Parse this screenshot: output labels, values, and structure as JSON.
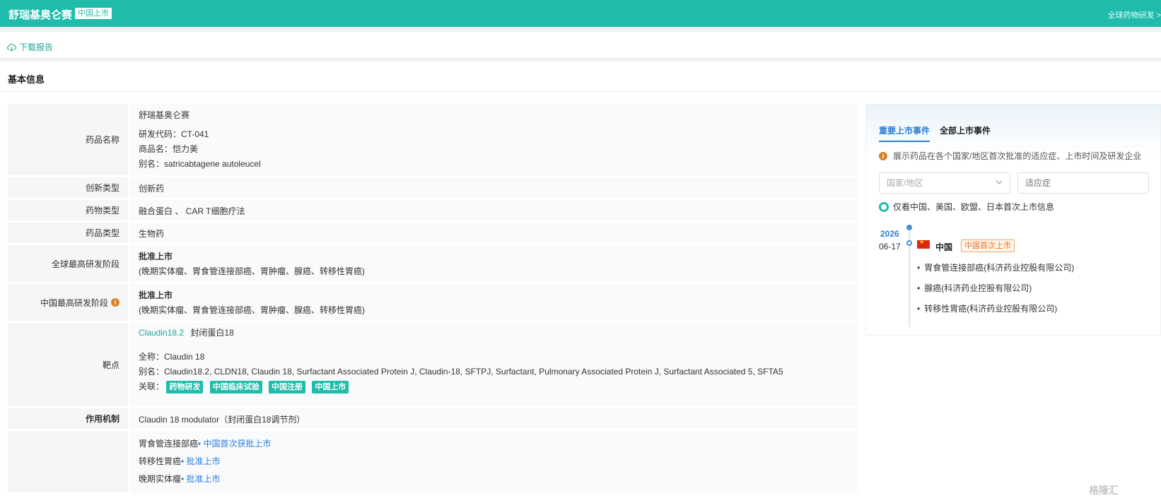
{
  "header": {
    "title": "舒瑞基奥仑赛",
    "badge": "中国上市",
    "global_link": "全球药物研发 >"
  },
  "toolbar": {
    "download_label": "下载报告"
  },
  "section": {
    "title": "基本信息"
  },
  "info": {
    "name": {
      "label": "药品名称",
      "main": "舒瑞基奥仑赛",
      "code": "研发代码：CT-041",
      "brand": "商品名：恺力美",
      "alias": "别名：satricabtagene autoleucel"
    },
    "innovation": {
      "label": "创新类型",
      "value": "创新药"
    },
    "drug_type": {
      "label": "药物类型",
      "value": "融合蛋白 、 CAR T细胞疗法"
    },
    "product_type": {
      "label": "药品类型",
      "value": "生物药"
    },
    "global_stage": {
      "label": "全球最高研发阶段",
      "stage": "批准上市",
      "detail": "(晚期实体瘤、胃食管连接部癌、胃肿瘤、腺癌、转移性胃癌)"
    },
    "china_stage": {
      "label": "中国最高研发阶段",
      "stage": "批准上市",
      "detail": "(晚期实体瘤、胃食管连接部癌、胃肿瘤、腺癌、转移性胃癌)"
    },
    "target": {
      "label": "靶点",
      "name": "Claudin18.2",
      "cn_name": "封闭蛋白18",
      "fullname": "全称：Claudin 18",
      "alias": "别名：Claudin18.2, CLDN18, Claudin 18, Surfactant Associated Protein J, Claudin-18, SFTPJ, Surfactant, Pulmonary Associated Protein J, Surfactant Associated 5, SFTA5",
      "related_label": "关联：",
      "tags": [
        "药物研发",
        "中国临床试验",
        "中国注册",
        "中国上市"
      ]
    },
    "mechanism": {
      "label": "作用机制",
      "value": "Claudin 18 modulator（封闭蛋白18调节剂）"
    },
    "indications": [
      {
        "name": "胃食管连接部癌",
        "status": "• 中国首次获批上市"
      },
      {
        "name": "转移性胃癌",
        "status": "• 批准上市"
      },
      {
        "name": "晚期实体瘤",
        "status": "• 批准上市"
      }
    ]
  },
  "panel": {
    "tabs": [
      "重要上市事件",
      "全部上市事件"
    ],
    "description": "展示药品在各个国家/地区首次批准的适应症、上市时间及研发企业",
    "country_placeholder": "国家/地区",
    "indication_placeholder": "适应症",
    "checkbox_label": "仅看中国、美国、欧盟、日本首次上市信息",
    "timeline": {
      "year": "2026",
      "date": "06-17",
      "country": "中国",
      "badge": "中国首次上市",
      "events": [
        "胃食管连接部癌(科济药业控股有限公司)",
        "腺癌(科济药业控股有限公司)",
        "转移性胃癌(科济药业控股有限公司)"
      ]
    }
  },
  "watermark": "格隆汇",
  "colors": {
    "brand": "#1fbcab",
    "link_blue": "#2d7fd6",
    "warning_orange": "#e8701a"
  }
}
